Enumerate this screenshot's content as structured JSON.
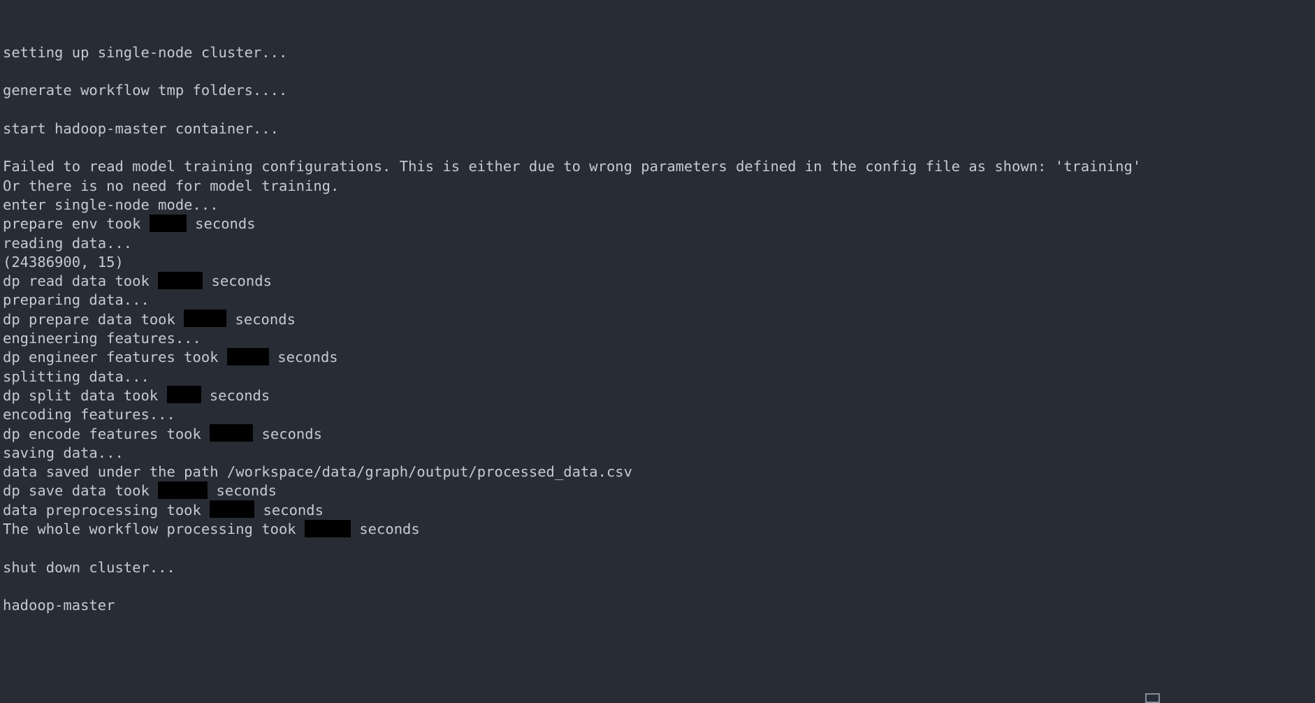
{
  "terminal": {
    "background_color": "#282c34",
    "text_color": "#c6cad3",
    "redaction_color": "#000000",
    "cursor_outline_color": "#868d9c",
    "lines": [
      {
        "type": "text",
        "text": "setting up single-node cluster..."
      },
      {
        "type": "blank"
      },
      {
        "type": "text",
        "text": "generate workflow tmp folders...."
      },
      {
        "type": "blank"
      },
      {
        "type": "text",
        "text": "start hadoop-master container..."
      },
      {
        "type": "blank"
      },
      {
        "type": "text",
        "text": "Failed to read model training configurations. This is either due to wrong parameters defined in the config file as shown: 'training'"
      },
      {
        "type": "text",
        "text": "Or there is no need for model training."
      },
      {
        "type": "text",
        "text": "enter single-node mode..."
      },
      {
        "type": "redacted",
        "before": "prepare env took ",
        "redaction_width": 53,
        "after": " seconds"
      },
      {
        "type": "text",
        "text": "reading data..."
      },
      {
        "type": "text",
        "text": "(24386900, 15)"
      },
      {
        "type": "redacted",
        "before": "dp read data took ",
        "redaction_width": 64,
        "after": " seconds"
      },
      {
        "type": "text",
        "text": "preparing data..."
      },
      {
        "type": "redacted",
        "before": "dp prepare data took ",
        "redaction_width": 61,
        "after": " seconds"
      },
      {
        "type": "text",
        "text": "engineering features..."
      },
      {
        "type": "redacted",
        "before": "dp engineer features took ",
        "redaction_width": 60,
        "after": " seconds"
      },
      {
        "type": "text",
        "text": "splitting data..."
      },
      {
        "type": "redacted",
        "before": "dp split data took ",
        "redaction_width": 49,
        "after": " seconds"
      },
      {
        "type": "text",
        "text": "encoding features..."
      },
      {
        "type": "redacted",
        "before": "dp encode features took ",
        "redaction_width": 62,
        "after": " seconds"
      },
      {
        "type": "text",
        "text": "saving data..."
      },
      {
        "type": "text",
        "text": "data saved under the path /workspace/data/graph/output/processed_data.csv"
      },
      {
        "type": "redacted",
        "before": "dp save data took ",
        "redaction_width": 71,
        "after": " seconds"
      },
      {
        "type": "redacted",
        "before": "data preprocessing took ",
        "redaction_width": 64,
        "after": " seconds"
      },
      {
        "type": "redacted",
        "before": "The whole workflow processing took ",
        "redaction_width": 66,
        "after": " seconds"
      },
      {
        "type": "blank"
      },
      {
        "type": "text",
        "text": "shut down cluster..."
      },
      {
        "type": "blank"
      },
      {
        "type": "text",
        "text": "hadoop-master"
      }
    ]
  }
}
